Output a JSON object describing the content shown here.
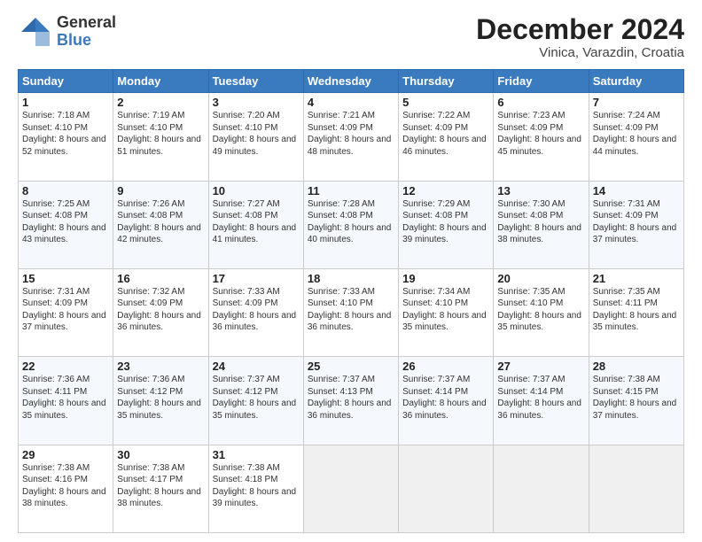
{
  "logo": {
    "general": "General",
    "blue": "Blue"
  },
  "title": "December 2024",
  "location": "Vinica, Varazdin, Croatia",
  "weekdays": [
    "Sunday",
    "Monday",
    "Tuesday",
    "Wednesday",
    "Thursday",
    "Friday",
    "Saturday"
  ],
  "weeks": [
    [
      {
        "day": 1,
        "rise": "7:18 AM",
        "set": "4:10 PM",
        "daylight": "8 hours and 52 minutes."
      },
      {
        "day": 2,
        "rise": "7:19 AM",
        "set": "4:10 PM",
        "daylight": "8 hours and 51 minutes."
      },
      {
        "day": 3,
        "rise": "7:20 AM",
        "set": "4:10 PM",
        "daylight": "8 hours and 49 minutes."
      },
      {
        "day": 4,
        "rise": "7:21 AM",
        "set": "4:09 PM",
        "daylight": "8 hours and 48 minutes."
      },
      {
        "day": 5,
        "rise": "7:22 AM",
        "set": "4:09 PM",
        "daylight": "8 hours and 46 minutes."
      },
      {
        "day": 6,
        "rise": "7:23 AM",
        "set": "4:09 PM",
        "daylight": "8 hours and 45 minutes."
      },
      {
        "day": 7,
        "rise": "7:24 AM",
        "set": "4:09 PM",
        "daylight": "8 hours and 44 minutes."
      }
    ],
    [
      {
        "day": 8,
        "rise": "7:25 AM",
        "set": "4:08 PM",
        "daylight": "8 hours and 43 minutes."
      },
      {
        "day": 9,
        "rise": "7:26 AM",
        "set": "4:08 PM",
        "daylight": "8 hours and 42 minutes."
      },
      {
        "day": 10,
        "rise": "7:27 AM",
        "set": "4:08 PM",
        "daylight": "8 hours and 41 minutes."
      },
      {
        "day": 11,
        "rise": "7:28 AM",
        "set": "4:08 PM",
        "daylight": "8 hours and 40 minutes."
      },
      {
        "day": 12,
        "rise": "7:29 AM",
        "set": "4:08 PM",
        "daylight": "8 hours and 39 minutes."
      },
      {
        "day": 13,
        "rise": "7:30 AM",
        "set": "4:08 PM",
        "daylight": "8 hours and 38 minutes."
      },
      {
        "day": 14,
        "rise": "7:31 AM",
        "set": "4:09 PM",
        "daylight": "8 hours and 37 minutes."
      }
    ],
    [
      {
        "day": 15,
        "rise": "7:31 AM",
        "set": "4:09 PM",
        "daylight": "8 hours and 37 minutes."
      },
      {
        "day": 16,
        "rise": "7:32 AM",
        "set": "4:09 PM",
        "daylight": "8 hours and 36 minutes."
      },
      {
        "day": 17,
        "rise": "7:33 AM",
        "set": "4:09 PM",
        "daylight": "8 hours and 36 minutes."
      },
      {
        "day": 18,
        "rise": "7:33 AM",
        "set": "4:10 PM",
        "daylight": "8 hours and 36 minutes."
      },
      {
        "day": 19,
        "rise": "7:34 AM",
        "set": "4:10 PM",
        "daylight": "8 hours and 35 minutes."
      },
      {
        "day": 20,
        "rise": "7:35 AM",
        "set": "4:10 PM",
        "daylight": "8 hours and 35 minutes."
      },
      {
        "day": 21,
        "rise": "7:35 AM",
        "set": "4:11 PM",
        "daylight": "8 hours and 35 minutes."
      }
    ],
    [
      {
        "day": 22,
        "rise": "7:36 AM",
        "set": "4:11 PM",
        "daylight": "8 hours and 35 minutes."
      },
      {
        "day": 23,
        "rise": "7:36 AM",
        "set": "4:12 PM",
        "daylight": "8 hours and 35 minutes."
      },
      {
        "day": 24,
        "rise": "7:37 AM",
        "set": "4:12 PM",
        "daylight": "8 hours and 35 minutes."
      },
      {
        "day": 25,
        "rise": "7:37 AM",
        "set": "4:13 PM",
        "daylight": "8 hours and 36 minutes."
      },
      {
        "day": 26,
        "rise": "7:37 AM",
        "set": "4:14 PM",
        "daylight": "8 hours and 36 minutes."
      },
      {
        "day": 27,
        "rise": "7:37 AM",
        "set": "4:14 PM",
        "daylight": "8 hours and 36 minutes."
      },
      {
        "day": 28,
        "rise": "7:38 AM",
        "set": "4:15 PM",
        "daylight": "8 hours and 37 minutes."
      }
    ],
    [
      {
        "day": 29,
        "rise": "7:38 AM",
        "set": "4:16 PM",
        "daylight": "8 hours and 38 minutes."
      },
      {
        "day": 30,
        "rise": "7:38 AM",
        "set": "4:17 PM",
        "daylight": "8 hours and 38 minutes."
      },
      {
        "day": 31,
        "rise": "7:38 AM",
        "set": "4:18 PM",
        "daylight": "8 hours and 39 minutes."
      },
      null,
      null,
      null,
      null
    ]
  ],
  "labels": {
    "sunrise": "Sunrise:",
    "sunset": "Sunset:",
    "daylight": "Daylight:"
  }
}
